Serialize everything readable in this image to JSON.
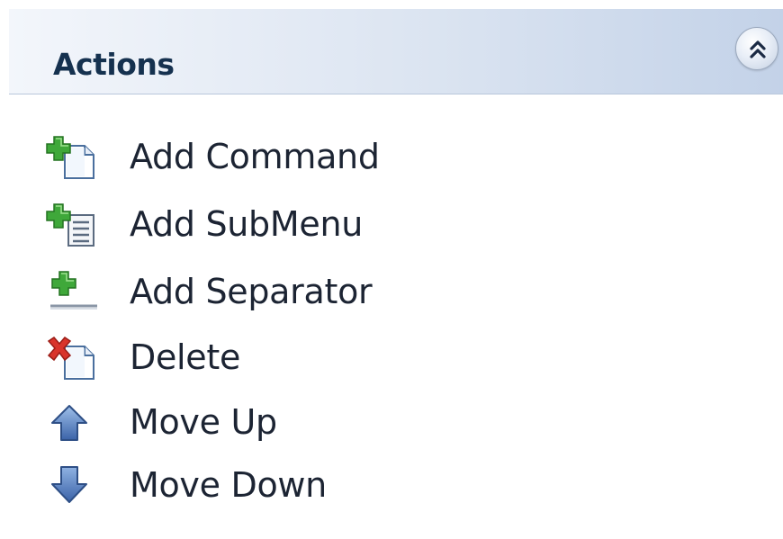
{
  "header": {
    "title": "Actions",
    "collapse_icon": "chevron-double-up-icon"
  },
  "actions": [
    {
      "label": "Add Command",
      "icon": "add-command-icon"
    },
    {
      "label": "Add SubMenu",
      "icon": "add-submenu-icon"
    },
    {
      "label": "Add Separator",
      "icon": "add-separator-icon"
    },
    {
      "label": "Delete",
      "icon": "delete-icon"
    },
    {
      "label": "Move Up",
      "icon": "move-up-icon"
    },
    {
      "label": "Move Down",
      "icon": "move-down-icon"
    }
  ],
  "colors": {
    "header_gradient_start": "#f3f6fb",
    "header_gradient_end": "#c3d2e8",
    "title_text": "#15314f",
    "item_text": "#1c2433",
    "plus_green": "#3fa83a",
    "delete_red": "#d9342b",
    "arrow_blue": "#4b74b8"
  }
}
